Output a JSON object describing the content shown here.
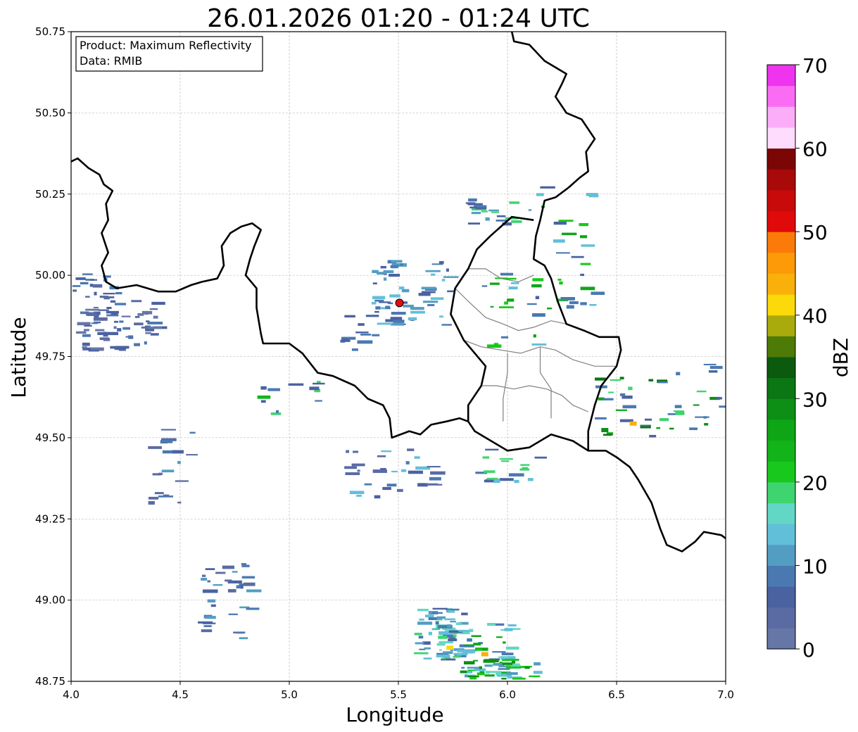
{
  "title": "26.01.2026 01:20 - 01:24 UTC",
  "xlabel": "Longitude",
  "ylabel": "Latitude",
  "info_box": {
    "line1": "Product: Maximum Reflectivity",
    "line2": "Data: RMIB"
  },
  "colorbar": {
    "label": "dBZ",
    "min": 0,
    "max": 70,
    "ticks": [
      "0",
      "10",
      "20",
      "30",
      "40",
      "50",
      "60",
      "70"
    ],
    "colors": [
      "#6676a6",
      "#5a6ba3",
      "#4b62a1",
      "#4a79b1",
      "#539dc3",
      "#62bfd9",
      "#62d7c6",
      "#3ed46f",
      "#18c81c",
      "#12b41a",
      "#0ea617",
      "#0d8f16",
      "#0b7614",
      "#0b5a0e",
      "#4e7a08",
      "#a8ab0b",
      "#fcd90a",
      "#fab00a",
      "#fc9a08",
      "#fb7b08",
      "#e00a0a",
      "#c80a0a",
      "#a80a0a",
      "#7a0606",
      "#fddcfe",
      "#fcadf8",
      "#fb6cf4",
      "#ef34ef"
    ]
  },
  "chart_data": {
    "type": "heatmap",
    "title": "26.01.2026 01:20 - 01:24 UTC",
    "xlabel": "Longitude",
    "ylabel": "Latitude",
    "xlim": [
      4.0,
      7.0
    ],
    "ylim": [
      48.75,
      50.75
    ],
    "xticks": [
      "4.0",
      "4.5",
      "5.0",
      "5.5",
      "6.0",
      "6.5",
      "7.0"
    ],
    "yticks": [
      "48.75",
      "49.00",
      "49.25",
      "49.50",
      "49.75",
      "50.00",
      "50.25",
      "50.50",
      "50.75"
    ],
    "grid": true,
    "radar_site": {
      "lon": 5.505,
      "lat": 49.915,
      "color": "#e01010"
    },
    "borders_national": [
      [
        [
          4.0,
          50.35
        ],
        [
          4.03,
          50.36
        ],
        [
          4.08,
          50.33
        ],
        [
          4.13,
          50.31
        ],
        [
          4.15,
          50.28
        ],
        [
          4.19,
          50.26
        ],
        [
          4.16,
          50.22
        ],
        [
          4.17,
          50.17
        ],
        [
          4.14,
          50.13
        ],
        [
          4.17,
          50.07
        ],
        [
          4.14,
          50.03
        ],
        [
          4.16,
          49.98
        ],
        [
          4.21,
          49.96
        ],
        [
          4.3,
          49.97
        ],
        [
          4.4,
          49.95
        ],
        [
          4.48,
          49.95
        ],
        [
          4.55,
          49.97
        ],
        [
          4.6,
          49.98
        ],
        [
          4.67,
          49.99
        ],
        [
          4.7,
          50.03
        ],
        [
          4.69,
          50.09
        ],
        [
          4.73,
          50.13
        ],
        [
          4.78,
          50.15
        ],
        [
          4.83,
          50.16
        ],
        [
          4.87,
          50.14
        ],
        [
          4.84,
          50.09
        ],
        [
          4.82,
          50.05
        ],
        [
          4.8,
          50.0
        ],
        [
          4.85,
          49.96
        ],
        [
          4.85,
          49.9
        ],
        [
          4.87,
          49.82
        ],
        [
          4.88,
          49.79
        ],
        [
          4.95,
          49.79
        ],
        [
          5.0,
          49.79
        ],
        [
          5.06,
          49.76
        ],
        [
          5.13,
          49.7
        ],
        [
          5.2,
          49.69
        ],
        [
          5.3,
          49.66
        ],
        [
          5.36,
          49.62
        ],
        [
          5.43,
          49.6
        ],
        [
          5.46,
          49.56
        ],
        [
          5.47,
          49.5
        ],
        [
          5.55,
          49.52
        ],
        [
          5.6,
          49.51
        ],
        [
          5.65,
          49.54
        ],
        [
          5.72,
          49.55
        ],
        [
          5.78,
          49.56
        ],
        [
          5.82,
          49.55
        ],
        [
          5.85,
          49.52
        ],
        [
          5.9,
          49.5
        ],
        [
          6.0,
          49.46
        ],
        [
          6.1,
          49.47
        ],
        [
          6.2,
          49.51
        ],
        [
          6.3,
          49.49
        ],
        [
          6.37,
          49.46
        ],
        [
          6.45,
          49.46
        ],
        [
          6.5,
          49.44
        ],
        [
          6.56,
          49.41
        ],
        [
          6.6,
          49.37
        ],
        [
          6.66,
          49.3
        ],
        [
          6.7,
          49.22
        ],
        [
          6.73,
          49.17
        ],
        [
          6.8,
          49.15
        ],
        [
          6.86,
          49.18
        ],
        [
          6.9,
          49.21
        ],
        [
          6.98,
          49.2
        ],
        [
          7.0,
          49.19
        ]
      ],
      [
        [
          6.02,
          50.75
        ],
        [
          6.03,
          50.72
        ],
        [
          6.1,
          50.71
        ],
        [
          6.17,
          50.66
        ],
        [
          6.27,
          50.62
        ],
        [
          6.25,
          50.59
        ],
        [
          6.22,
          50.55
        ],
        [
          6.27,
          50.5
        ],
        [
          6.34,
          50.48
        ],
        [
          6.4,
          50.42
        ],
        [
          6.36,
          50.38
        ],
        [
          6.37,
          50.32
        ],
        [
          6.33,
          50.3
        ],
        [
          6.28,
          50.27
        ],
        [
          6.22,
          50.24
        ],
        [
          6.17,
          50.23
        ],
        [
          6.15,
          50.17
        ],
        [
          6.13,
          50.12
        ],
        [
          6.12,
          50.05
        ],
        [
          6.17,
          50.03
        ],
        [
          6.2,
          49.99
        ],
        [
          6.23,
          49.92
        ],
        [
          6.27,
          49.85
        ],
        [
          6.35,
          49.83
        ],
        [
          6.42,
          49.81
        ],
        [
          6.51,
          49.81
        ],
        [
          6.52,
          49.77
        ],
        [
          6.5,
          49.72
        ],
        [
          6.43,
          49.66
        ],
        [
          6.4,
          49.6
        ],
        [
          6.37,
          49.52
        ],
        [
          6.37,
          49.46
        ]
      ],
      [
        [
          6.12,
          50.17
        ],
        [
          6.02,
          50.18
        ],
        [
          5.97,
          50.15
        ],
        [
          5.92,
          50.12
        ],
        [
          5.86,
          50.08
        ],
        [
          5.82,
          50.02
        ],
        [
          5.76,
          49.96
        ],
        [
          5.74,
          49.88
        ],
        [
          5.8,
          49.8
        ],
        [
          5.9,
          49.72
        ],
        [
          5.88,
          49.66
        ],
        [
          5.82,
          49.6
        ],
        [
          5.82,
          49.55
        ]
      ]
    ],
    "borders_regional": [
      [
        [
          5.82,
          50.02
        ],
        [
          5.9,
          50.02
        ],
        [
          5.97,
          49.99
        ],
        [
          6.05,
          49.98
        ],
        [
          6.12,
          50.0
        ]
      ],
      [
        [
          5.76,
          49.96
        ],
        [
          5.82,
          49.92
        ],
        [
          5.9,
          49.87
        ],
        [
          5.98,
          49.85
        ],
        [
          6.05,
          49.83
        ],
        [
          6.12,
          49.84
        ],
        [
          6.2,
          49.86
        ],
        [
          6.27,
          49.85
        ]
      ],
      [
        [
          5.8,
          49.8
        ],
        [
          5.88,
          49.78
        ],
        [
          5.97,
          49.77
        ],
        [
          6.06,
          49.76
        ],
        [
          6.15,
          49.78
        ],
        [
          6.22,
          49.77
        ],
        [
          6.3,
          49.74
        ],
        [
          6.4,
          49.72
        ],
        [
          6.5,
          49.72
        ]
      ],
      [
        [
          5.88,
          49.66
        ],
        [
          5.95,
          49.66
        ],
        [
          6.03,
          49.65
        ],
        [
          6.1,
          49.66
        ],
        [
          6.18,
          49.65
        ],
        [
          6.25,
          49.63
        ],
        [
          6.3,
          49.6
        ],
        [
          6.37,
          49.58
        ]
      ],
      [
        [
          6.0,
          49.76
        ],
        [
          6.0,
          49.7
        ],
        [
          5.98,
          49.62
        ],
        [
          5.98,
          49.55
        ]
      ],
      [
        [
          6.15,
          49.78
        ],
        [
          6.15,
          49.7
        ],
        [
          6.2,
          49.65
        ],
        [
          6.2,
          49.56
        ]
      ]
    ],
    "echoes_dBZ_approx": "scattered light echoes mostly 0-15 dBZ; strongest cells ~25-35 dBZ near 5.7-5.95E 48.75-48.9N; isolated ~40-45 dBZ near 6.55E 49.55N"
  }
}
